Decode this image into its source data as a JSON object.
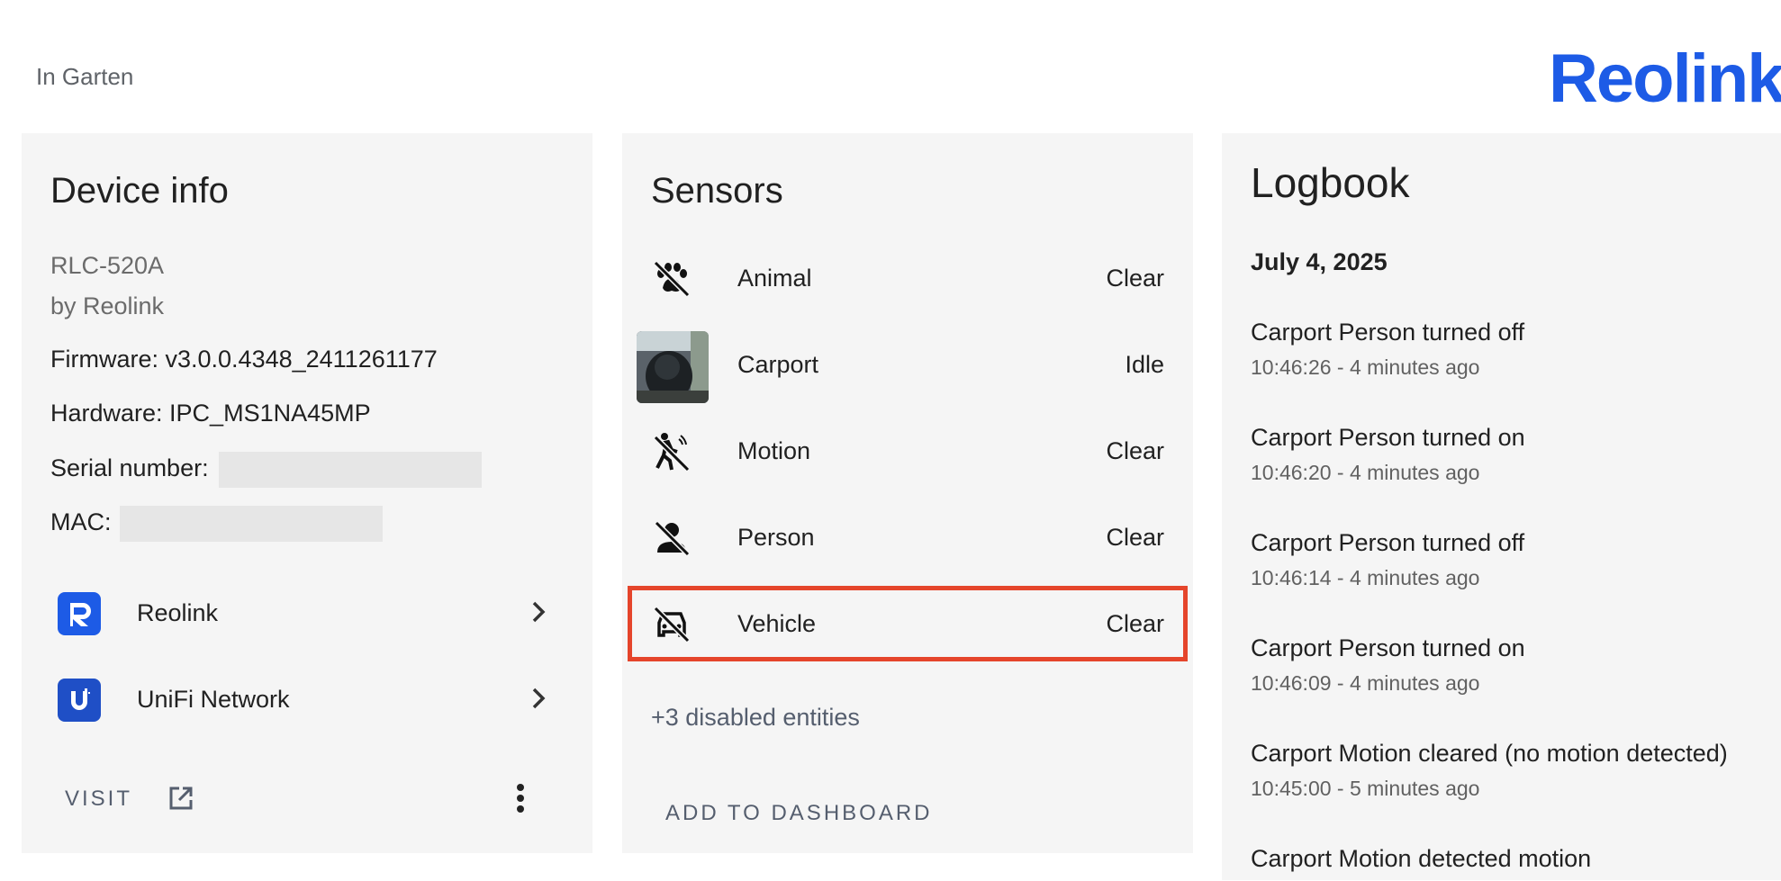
{
  "header": {
    "area": "In Garten",
    "brand": "Reolink"
  },
  "device_info": {
    "title": "Device info",
    "model": "RLC-520A",
    "manufacturer": "by Reolink",
    "firmware": "Firmware: v3.0.0.4348_2411261177",
    "hardware": "Hardware: IPC_MS1NA45MP",
    "serial_label": "Serial number:",
    "mac_label": "MAC:",
    "integrations": [
      {
        "label": "Reolink",
        "icon": "reolink-logo-icon"
      },
      {
        "label": "UniFi Network",
        "icon": "unifi-logo-icon"
      }
    ],
    "visit_label": "VISIT"
  },
  "sensors": {
    "title": "Sensors",
    "items": [
      {
        "name": "Animal",
        "state": "Clear",
        "icon": "paw-off-icon"
      },
      {
        "name": "Carport",
        "state": "Idle",
        "icon": "camera-thumbnail"
      },
      {
        "name": "Motion",
        "state": "Clear",
        "icon": "motion-sensor-off-icon"
      },
      {
        "name": "Person",
        "state": "Clear",
        "icon": "account-off-icon"
      },
      {
        "name": "Vehicle",
        "state": "Clear",
        "icon": "car-off-icon"
      }
    ],
    "disabled_entities": "+3 disabled entities",
    "add_to_dashboard": "ADD TO DASHBOARD"
  },
  "logbook": {
    "title": "Logbook",
    "date": "July 4, 2025",
    "entries": [
      {
        "message": "Carport Person turned off",
        "time": "10:46:26 - 4 minutes ago"
      },
      {
        "message": "Carport Person turned on",
        "time": "10:46:20 - 4 minutes ago"
      },
      {
        "message": "Carport Person turned off",
        "time": "10:46:14 - 4 minutes ago"
      },
      {
        "message": "Carport Person turned on",
        "time": "10:46:09 - 4 minutes ago"
      },
      {
        "message": "Carport Motion cleared (no motion detected)",
        "time": "10:45:00 - 5 minutes ago"
      },
      {
        "message": "Carport Motion detected motion",
        "time": ""
      }
    ]
  },
  "colors": {
    "accent": "#1d5be6",
    "highlight": "#e5452b",
    "card_bg": "#f5f5f5"
  }
}
